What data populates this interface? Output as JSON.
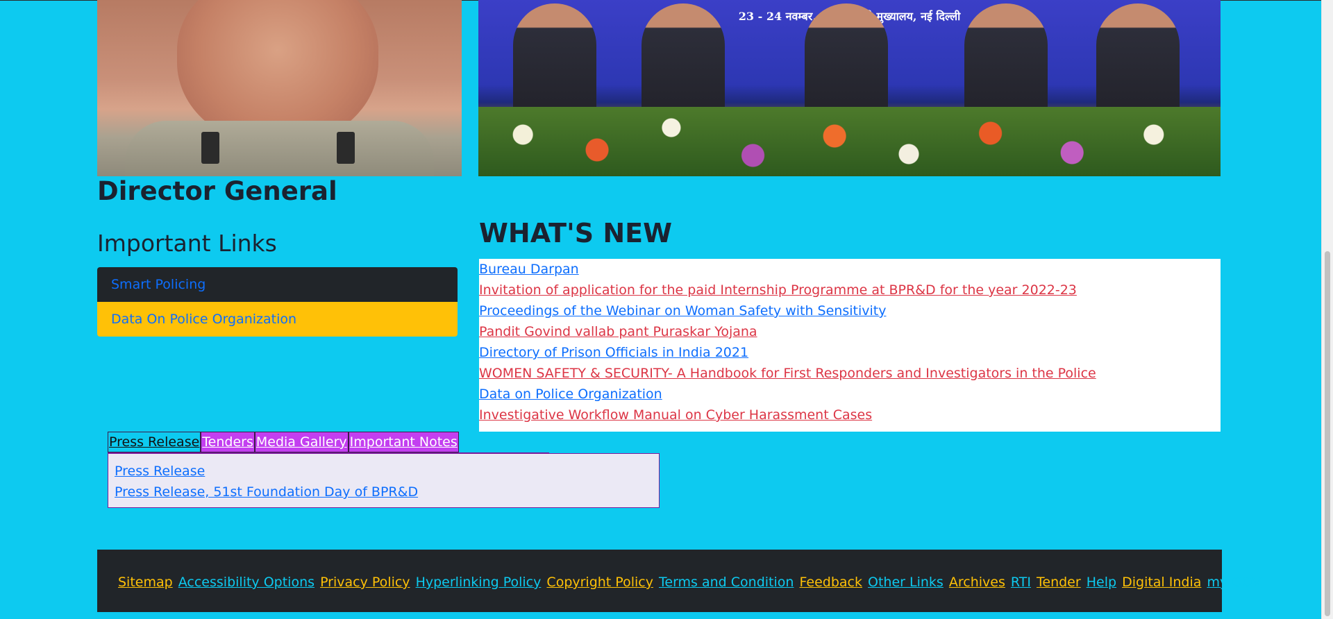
{
  "photos": {
    "event_banner_text": "23 - 24 नवम्बर, 2021  ब्यूरो मुख्यालय, नई दिल्ली"
  },
  "dg_section": {
    "title": "Director General"
  },
  "important_links": {
    "heading": "Important Links",
    "items": [
      {
        "label": "Smart Policing"
      },
      {
        "label": "Data On Police Organization"
      }
    ]
  },
  "whats_new": {
    "heading": "WHAT'S NEW",
    "items": [
      {
        "label": "Bureau Darpan",
        "color": "#0d6efd"
      },
      {
        "label": "Invitation of application for the paid Internship Programme at BPR&D for the year 2022-23",
        "color": "#dc3545"
      },
      {
        "label": "Proceedings of the Webinar on Woman Safety with Sensitivity",
        "color": "#0d6efd"
      },
      {
        "label": "Pandit Govind vallab pant Puraskar Yojana",
        "color": "#dc3545"
      },
      {
        "label": "Directory of Prison Officials in India 2021",
        "color": "#0d6efd"
      },
      {
        "label": "WOMEN SAFETY & SECURITY- A Handbook for First Responders and Investigators in the Police",
        "color": "#dc3545"
      },
      {
        "label": "Data on Police Organization",
        "color": "#0d6efd"
      },
      {
        "label": "Investigative Workflow Manual on Cyber Harassment Cases",
        "color": "#dc3545"
      }
    ]
  },
  "tabs": {
    "items": [
      {
        "label": "Press Release",
        "active": true
      },
      {
        "label": "Tenders",
        "active": false
      },
      {
        "label": "Media Gallery",
        "active": false
      },
      {
        "label": "Important Notes",
        "active": false
      }
    ],
    "panel_items": [
      {
        "label": "Press Release"
      },
      {
        "label": "Press Release, 51st Foundation Day of BPR&D"
      }
    ]
  },
  "footer": {
    "links": [
      {
        "label": "Sitemap",
        "color": "#ffc107"
      },
      {
        "label": "Accessibility Options",
        "color": "#0dcaf0"
      },
      {
        "label": "Privacy Policy",
        "color": "#ffc107"
      },
      {
        "label": "Hyperlinking Policy",
        "color": "#0dcaf0"
      },
      {
        "label": "Copyright Policy",
        "color": "#ffc107"
      },
      {
        "label": "Terms and Condition",
        "color": "#0dcaf0"
      },
      {
        "label": "Feedback",
        "color": "#ffc107"
      },
      {
        "label": "Other Links",
        "color": "#0dcaf0"
      },
      {
        "label": "Archives",
        "color": "#ffc107"
      },
      {
        "label": "RTI",
        "color": "#0dcaf0"
      },
      {
        "label": "Tender",
        "color": "#ffc107"
      },
      {
        "label": "Help",
        "color": "#0dcaf0"
      },
      {
        "label": "Digital India",
        "color": "#ffc107"
      },
      {
        "label": "my GOV",
        "color": "#0dcaf0"
      }
    ]
  },
  "colors": {
    "page_bg": "#0dcaf0",
    "heading": "#1b2230",
    "link_blue": "#0d6efd",
    "link_red": "#dc3545",
    "dark": "#212529",
    "yellow": "#ffc107",
    "tab_purple": "#c33ff0"
  }
}
